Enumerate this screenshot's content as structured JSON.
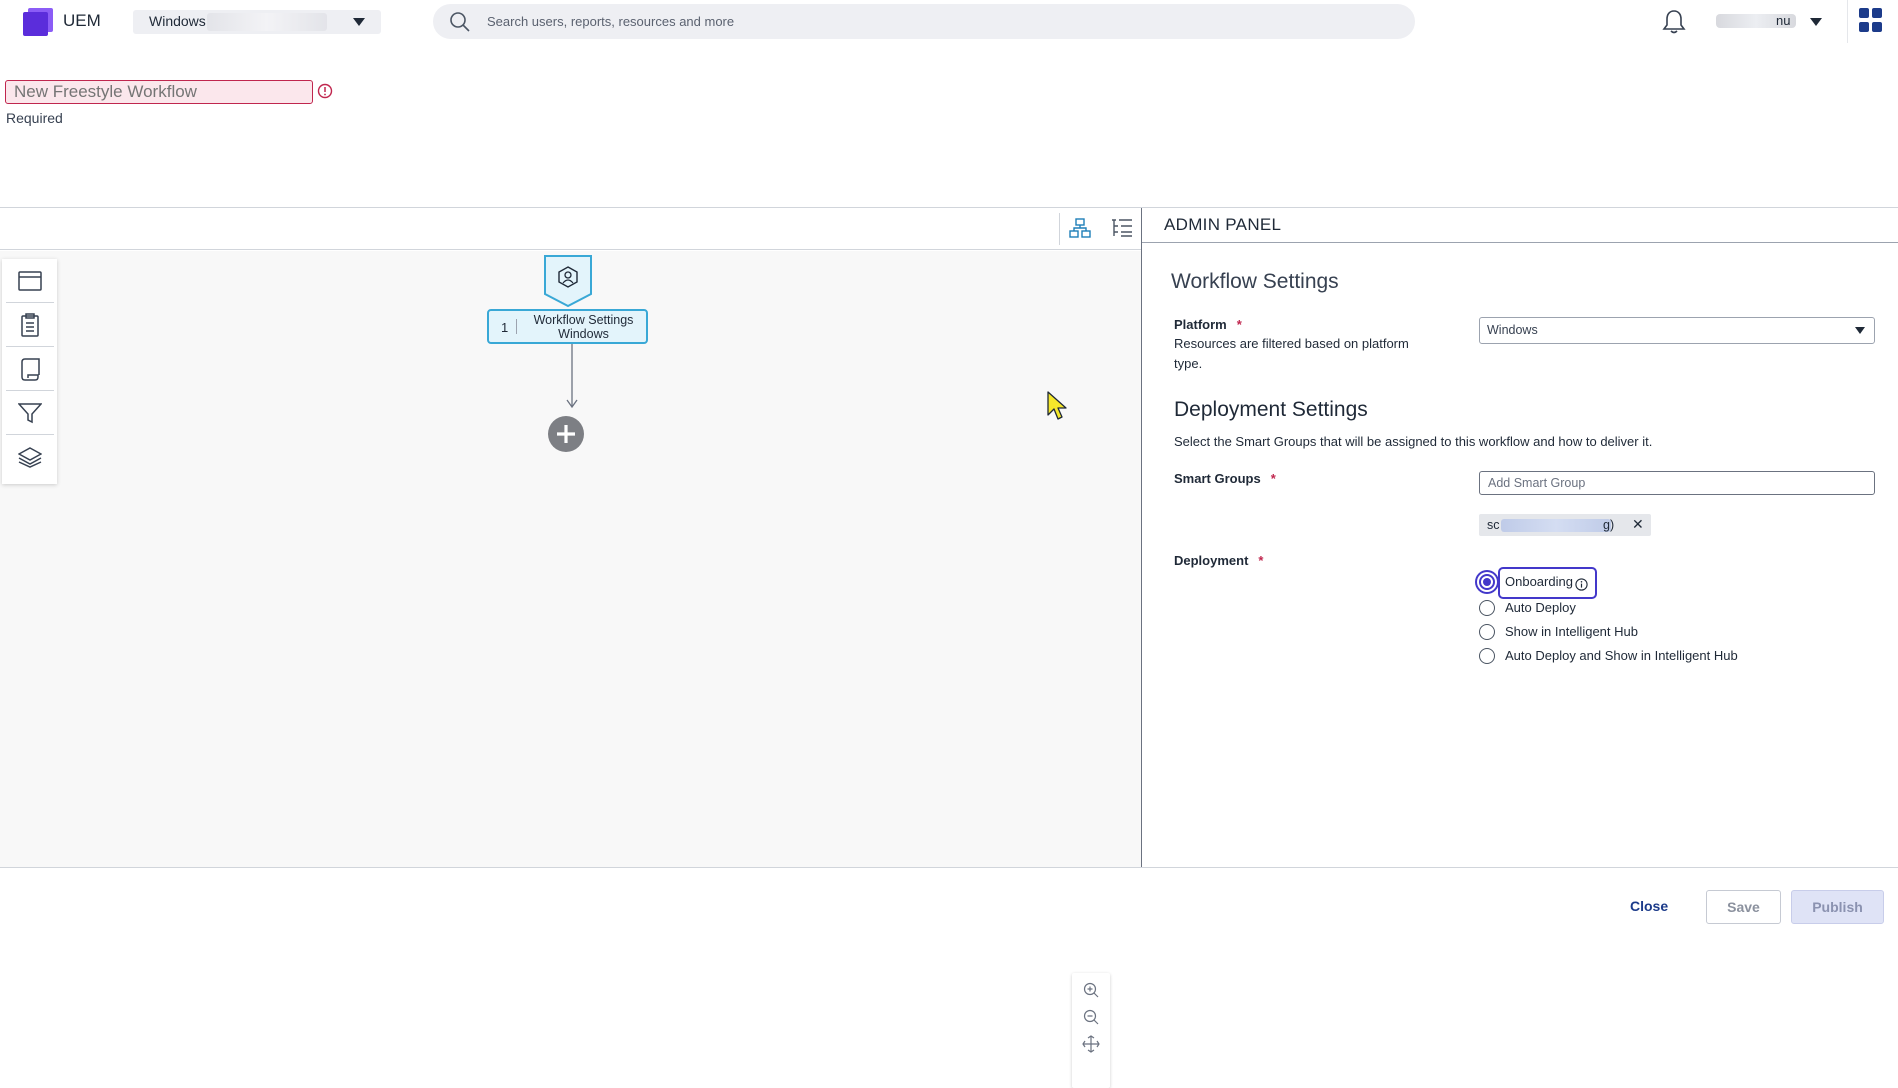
{
  "app": {
    "name": "UEM",
    "brand_color": "#5b2ddb"
  },
  "header": {
    "org_select_value": "Windows",
    "search_placeholder": "Search users, reports, resources and more",
    "user_name_tail": "nu",
    "icons": [
      "search-icon",
      "bell-icon",
      "chevron-down-icon",
      "apps-grid-icon"
    ]
  },
  "workflow": {
    "name": "New Freestyle Workflow",
    "name_error": "Required"
  },
  "canvas": {
    "view_icons": [
      "diagram-view-icon",
      "list-view-icon"
    ],
    "side_tools": [
      "window-icon",
      "clipboard-icon",
      "script-icon",
      "filter-icon",
      "layers-icon"
    ],
    "node": {
      "number": "1",
      "title": "Workflow Settings",
      "subtitle": "Windows"
    },
    "zoom_controls": [
      "zoom-in-icon",
      "zoom-out-icon",
      "fit-to-screen-icon"
    ]
  },
  "admin_panel": {
    "title": "ADMIN PANEL",
    "workflow_settings_title": "Workflow Settings",
    "platform": {
      "label": "Platform",
      "help": "Resources are filtered based on platform type.",
      "value": "Windows"
    },
    "deployment_settings": {
      "title": "Deployment Settings",
      "help": "Select the Smart Groups that will be assigned to this workflow and how to deliver it."
    },
    "smart_groups": {
      "label": "Smart Groups",
      "placeholder": "Add Smart Group",
      "chip_head": "sc",
      "chip_tail": "g)"
    },
    "deployment": {
      "label": "Deployment",
      "options": [
        {
          "label": "Onboarding",
          "checked": true
        },
        {
          "label": "Auto Deploy",
          "checked": false
        },
        {
          "label": "Show in Intelligent Hub",
          "checked": false
        },
        {
          "label": "Auto Deploy and Show in Intelligent Hub",
          "checked": false
        }
      ]
    }
  },
  "footer": {
    "close_label": "Close",
    "save_label": "Save",
    "publish_label": "Publish"
  }
}
